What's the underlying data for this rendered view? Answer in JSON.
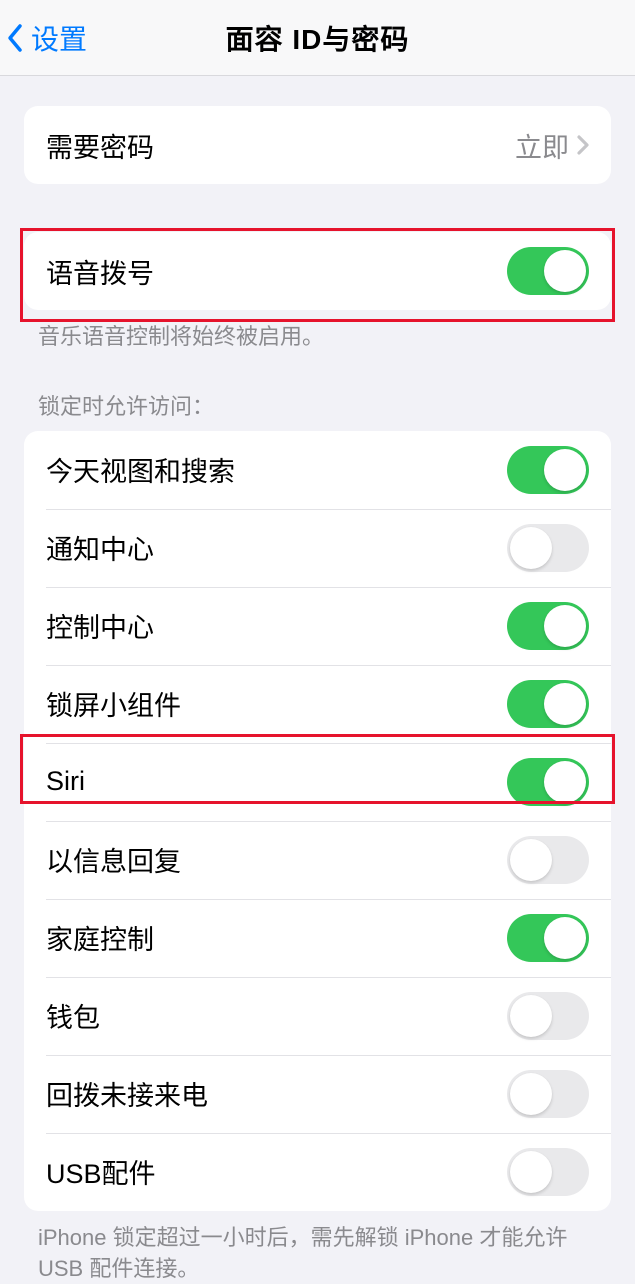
{
  "nav": {
    "back": "设置",
    "title": "面容 ID与密码"
  },
  "passcode": {
    "label": "需要密码",
    "value": "立即"
  },
  "voice_dial": {
    "label": "语音拨号",
    "on": true,
    "footer": "音乐语音控制将始终被启用。"
  },
  "lock_access": {
    "header": "锁定时允许访问：",
    "items": [
      {
        "label": "今天视图和搜索",
        "on": true
      },
      {
        "label": "通知中心",
        "on": false
      },
      {
        "label": "控制中心",
        "on": true
      },
      {
        "label": "锁屏小组件",
        "on": true
      },
      {
        "label": "Siri",
        "on": true
      },
      {
        "label": "以信息回复",
        "on": false
      },
      {
        "label": "家庭控制",
        "on": true
      },
      {
        "label": "钱包",
        "on": false
      },
      {
        "label": "回拨未接来电",
        "on": false
      },
      {
        "label": "USB配件",
        "on": false
      }
    ],
    "footer": "iPhone 锁定超过一小时后，需先解锁 iPhone 才能允许USB 配件连接。"
  }
}
